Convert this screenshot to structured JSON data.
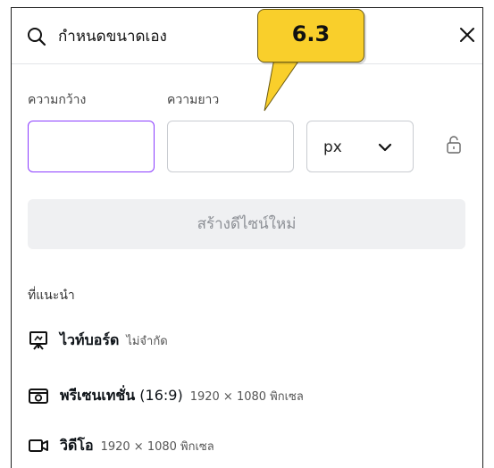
{
  "search": {
    "query": "กำหนดขนาดเอง"
  },
  "size_form": {
    "width_label": "ความกว้าง",
    "height_label": "ความยาว",
    "width_value": "",
    "height_value": "",
    "unit": "px",
    "create_button": "สร้างดีไซน์ใหม่"
  },
  "recommended": {
    "title": "ที่แนะนำ",
    "items": [
      {
        "name": "ไวท์บอร์ด",
        "detail": "ไม่จำกัด",
        "icon": "whiteboard-icon"
      },
      {
        "name": "พรีเซนเทชั่น",
        "name_suffix": " (16:9)",
        "detail": "1920 × 1080 พิกเซล",
        "icon": "presentation-icon"
      },
      {
        "name": "วิดีโอ",
        "detail": "1920 × 1080 พิกเซล",
        "icon": "video-icon"
      }
    ]
  },
  "callout": {
    "text": "6.3"
  },
  "colors": {
    "accent": "#8b3dff",
    "callout": "#f9cf2b",
    "button_bg": "#eff0f2"
  }
}
